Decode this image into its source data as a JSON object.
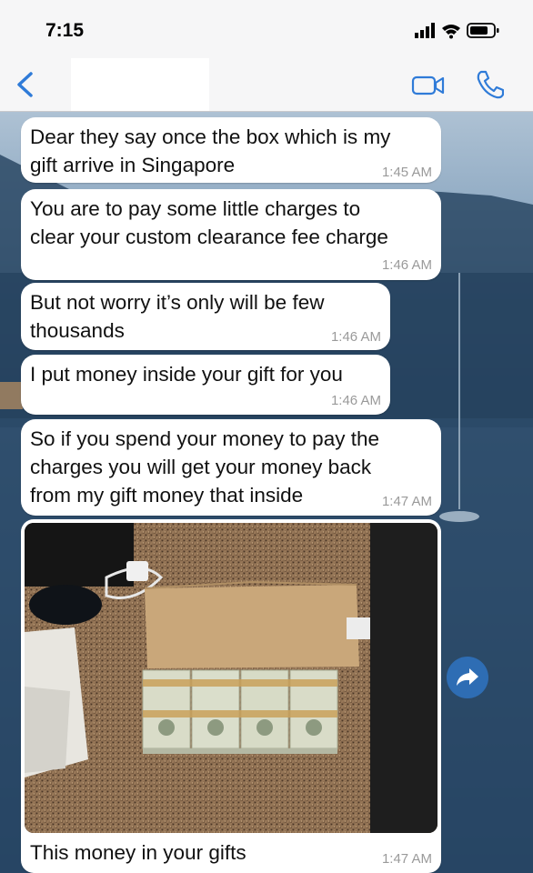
{
  "status_bar": {
    "time": "7:15",
    "icons": [
      "signal-icon",
      "wifi-icon",
      "battery-icon"
    ]
  },
  "nav": {
    "back_icon": "chevron-left-icon",
    "video_icon": "video-call-icon",
    "call_icon": "phone-icon",
    "accent": "#2f7bd8"
  },
  "messages": [
    {
      "text": "Dear they say once the box which is my\ngift arrive in Singapore",
      "time": "1:45 AM"
    },
    {
      "text": "You are to pay some little charges to\nclear your custom clearance fee charge",
      "time": "1:46 AM"
    },
    {
      "text": "But not worry it’s only will be few\nthousands",
      "time": "1:46 AM"
    },
    {
      "text": "I put money inside your gift for you",
      "time": "1:46 AM"
    },
    {
      "text": "So if you spend your money to pay the\ncharges you will get your money back\nfrom my gift money that inside",
      "time": "1:47 AM"
    },
    {
      "caption": "This money in your gifts",
      "time": "1:47 AM",
      "image": "photo-cash-stacks-on-counter"
    }
  ],
  "forward_icon": "forward-arrow-icon"
}
